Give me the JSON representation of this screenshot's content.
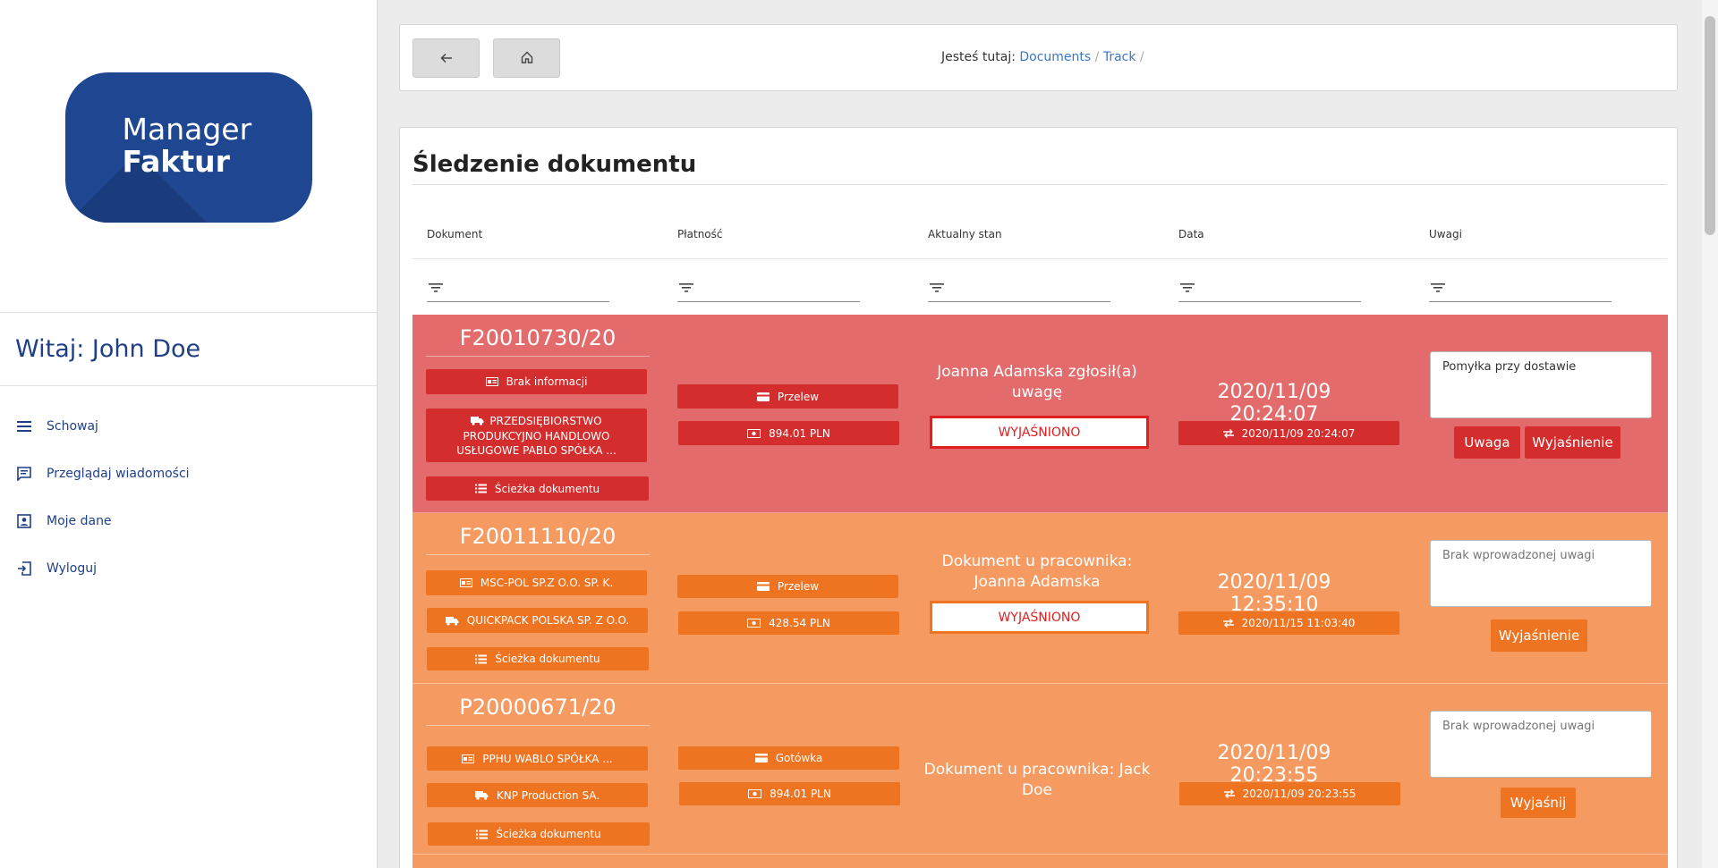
{
  "sidebar": {
    "logo": {
      "line1": "Manager",
      "line2": "Faktur"
    },
    "welcome": "Witaj: John Doe",
    "menu": [
      {
        "label": "Schowaj",
        "icon": "menu-icon"
      },
      {
        "label": "Przeglądaj wiadomości",
        "icon": "message-icon"
      },
      {
        "label": "Moje dane",
        "icon": "account-icon"
      },
      {
        "label": "Wyloguj",
        "icon": "logout-icon"
      }
    ]
  },
  "topbar": {
    "back_icon": "arrow-left-icon",
    "home_icon": "home-icon",
    "breadcrumb_prefix": "Jesteś tutaj:",
    "crumbs": [
      "Documents",
      "Track"
    ],
    "separator": "/"
  },
  "card": {
    "title": "Śledzenie dokumentu",
    "columns": [
      "Dokument",
      "Płatność",
      "Aktualny stan",
      "Data",
      "Uwagi"
    ]
  },
  "rows": [
    {
      "number": "F20010730/20",
      "sender": "Brak informacji",
      "recipient": "PRZEDSIĘBIORSTWO PRODUKCYJNO HANDLOWO USŁUGOWE PABLO SPÓŁKA ...",
      "path": "Ścieżka dokumentu",
      "payment_method": "Przelew",
      "amount": "894.01 PLN",
      "status": "Joanna Adamska zgłosił(a) uwagę",
      "status_badge": "WYJAŚNIONO",
      "date": "2020/11/09 20:24:07",
      "date_small": "2020/11/09 20:24:07",
      "note": "Pomyłka przy dostawie",
      "buttons": [
        "Uwaga",
        "Wyjaśnienie"
      ]
    },
    {
      "number": "F20011110/20",
      "sender": "MSC-POL SP.Z O.O. SP. K.",
      "recipient": "QUICKPACK POLSKA SP. Z O.O.",
      "path": "Ścieżka dokumentu",
      "payment_method": "Przelew",
      "amount": "428.54 PLN",
      "status": "Dokument u pracownika: Joanna Adamska",
      "status_badge": "WYJAŚNIONO",
      "date": "2020/11/09 12:35:10",
      "date_small": "2020/11/15 11:03:40",
      "note_placeholder": "Brak wprowadzonej uwagi",
      "buttons": [
        "Wyjaśnienie"
      ]
    },
    {
      "number": "P20000671/20",
      "sender": "PPHU WABLO SPÓŁKA ...",
      "recipient": "KNP Production SA.",
      "path": "Ścieżka dokumentu",
      "payment_method": "Gotówka",
      "amount": "894.01 PLN",
      "status": "Dokument u pracownika: Jack Doe",
      "date": "2020/11/09 20:23:55",
      "date_small": "2020/11/09 20:23:55",
      "note_placeholder": "Brak wprowadzonej uwagi",
      "buttons": [
        "Wyjaśnij"
      ]
    }
  ],
  "colors": {
    "brand": "#1f4690",
    "row_red": "#e46b6b",
    "pill_red": "#d42d2d",
    "row_orange": "#f59b62",
    "pill_orange": "#ee7422"
  }
}
